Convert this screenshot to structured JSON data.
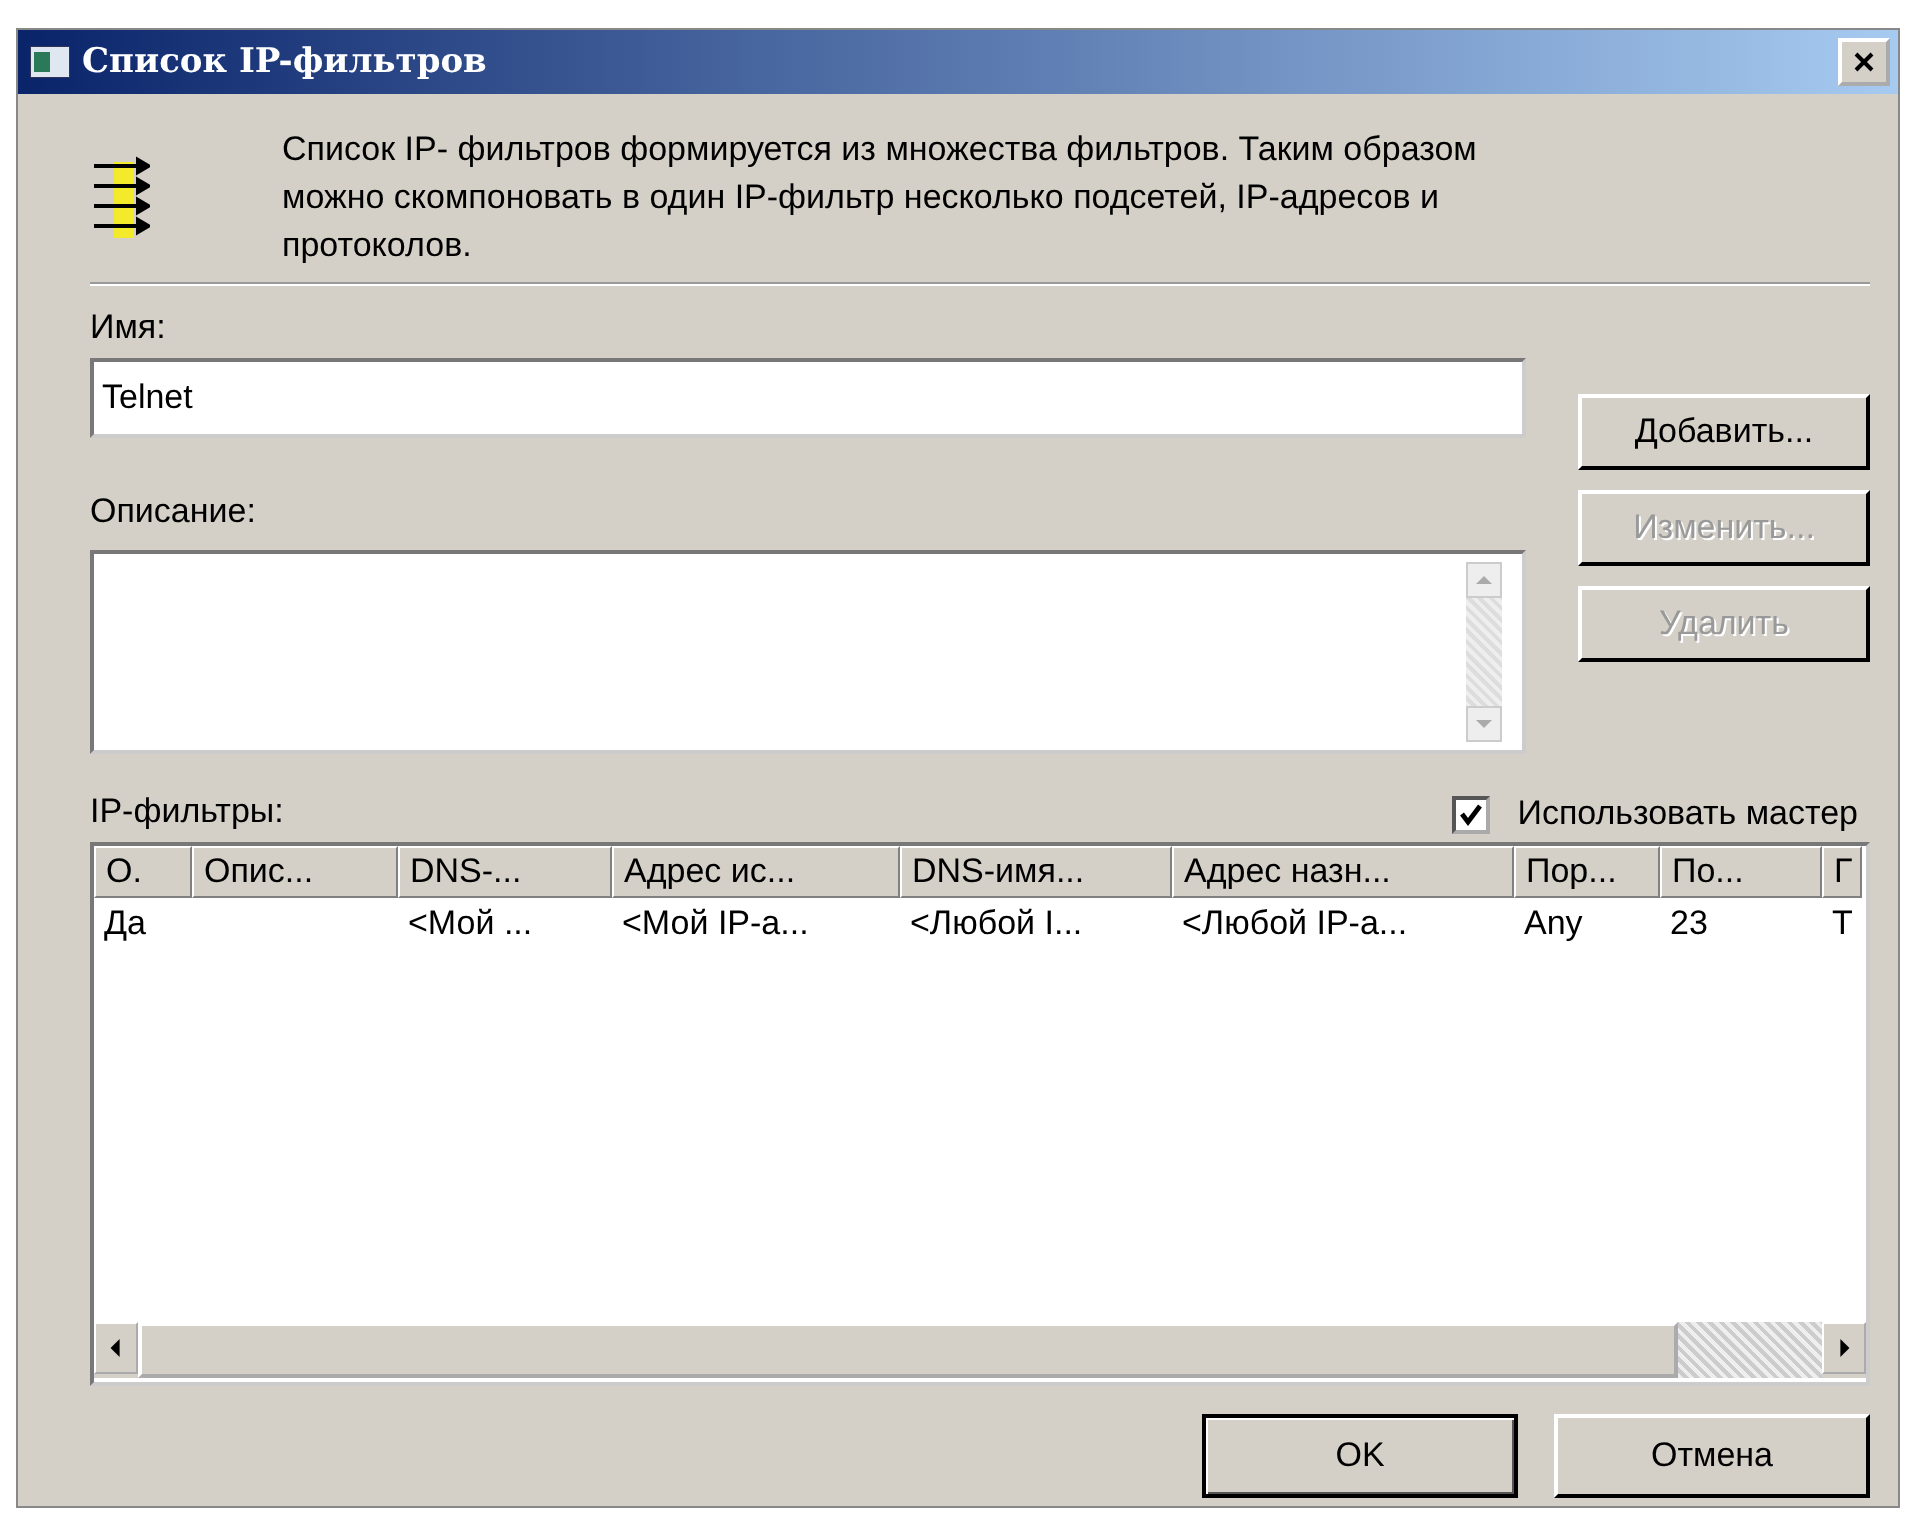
{
  "window": {
    "title": "Список IP-фильтров"
  },
  "intro": "Список IP- фильтров формируется из множества фильтров. Таким образом можно скомпоновать в один IP-фильтр несколько подсетей, IP-адресов и протоколов.",
  "name": {
    "label": "Имя:",
    "value": "Telnet"
  },
  "description": {
    "label": "Описание:"
  },
  "side_buttons": [
    {
      "label": "Добавить...",
      "disabled": false
    },
    {
      "label": "Изменить...",
      "disabled": true
    },
    {
      "label": "Удалить",
      "disabled": true
    }
  ],
  "filters_label": "IP-фильтры:",
  "use_wizard": {
    "label": "Использовать мастер",
    "checked": true
  },
  "table": {
    "columns": [
      "О.",
      "Опис...",
      "DNS-...",
      "Адрес ис...",
      "DNS-имя...",
      "Адрес назн...",
      "Пор...",
      "По...",
      "Г"
    ],
    "rows": [
      [
        "Да",
        "",
        "<Мой ...",
        "<Мой IP-а...",
        "<Любой I...",
        "<Любой IP-а...",
        "Any",
        "23",
        "Т"
      ]
    ]
  },
  "buttons": [
    "OK",
    "Отмена"
  ]
}
